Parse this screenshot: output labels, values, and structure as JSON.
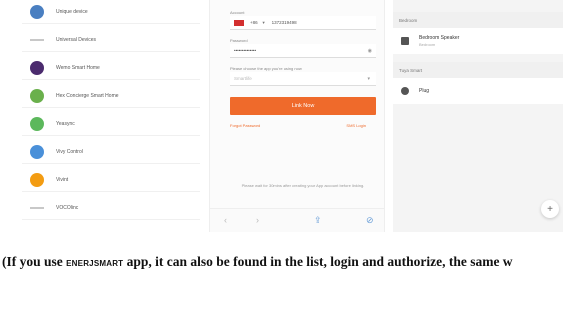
{
  "device_list": {
    "items": [
      {
        "label": "Unique device",
        "icon": "unique-device-icon",
        "color": "#4a7fc1"
      },
      {
        "label": "Universal Devices",
        "icon": "line-icon",
        "color": "#c8c8c8"
      },
      {
        "label": "Wemo Smart Home",
        "icon": "wemo-icon",
        "color": "#4b2b6e"
      },
      {
        "label": "Hex Concierge Smart Home",
        "icon": "hex-icon",
        "color": "#6ab04c"
      },
      {
        "label": "Yeasync",
        "icon": "yeasync-icon",
        "color": "#5cb85c"
      },
      {
        "label": "Vivy Control",
        "icon": "vivy-icon",
        "color": "#4a90d9"
      },
      {
        "label": "Vivint",
        "icon": "vivint-icon",
        "color": "#f39c12"
      },
      {
        "label": "VOCOlinc",
        "icon": "line-icon",
        "color": "#c8c8c8"
      }
    ]
  },
  "login": {
    "account_label": "Account",
    "country_code": "+86",
    "phone": "1372319498",
    "password_label": "Password",
    "password_value": "••••••••••••••",
    "app_prompt": "Please choose the app you're using now",
    "app_placeholder": "Smartlife",
    "link_button": "Link Now",
    "forgot": "Forgot Password",
    "sms_login": "SMS Login",
    "note": "Please wait for 30mins after creating your App account before linking."
  },
  "rooms": {
    "section1": "Bedroom",
    "device1_name": "Bedroom Speaker",
    "device1_room": "Bedroom",
    "section2": "Tuya Smart",
    "device2_name": "Plug",
    "fab": "+"
  },
  "caption": {
    "before": "(If you use ",
    "brand": "ENERJSMART",
    "after": " app, it can also be found in the list, login and    authorize, the same w"
  }
}
